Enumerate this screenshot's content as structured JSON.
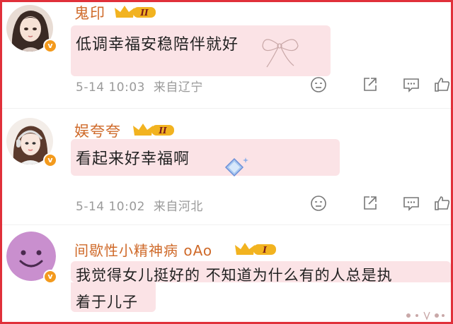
{
  "comments": [
    {
      "username": "鬼印",
      "level": "II",
      "text": "低调幸福安稳陪伴就好",
      "timestamp": "5-14 10:03",
      "location": "来自辽宁"
    },
    {
      "username": "娱夸夸",
      "level": "II",
      "text": "看起来好幸福啊",
      "timestamp": "5-14 10:02",
      "location": "来自河北"
    },
    {
      "username": "间歇性小精神病 oAo",
      "level": "I",
      "text_line1": "我觉得女儿挺好的 不知道为什么有的人总是执",
      "text_line2": "着于儿子"
    }
  ],
  "actions": [
    "more-icon",
    "share-icon",
    "comment-icon",
    "like-icon"
  ],
  "colors": {
    "username": "#cf6a2a",
    "bubble": "#fbe3e6",
    "meta": "#9a9a9a",
    "verified_badge": "#f39a1d",
    "crown": "#f2b320",
    "frame": "#e0303a"
  }
}
